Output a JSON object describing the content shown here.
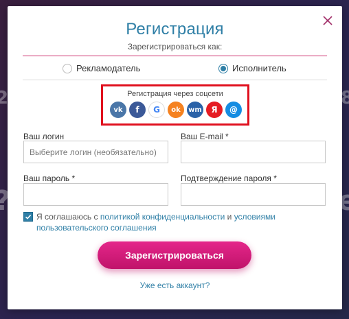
{
  "dialog": {
    "title": "Регистрация",
    "subtitle": "Зарегистрироваться как:",
    "close_icon": "close-icon"
  },
  "roles": {
    "advertiser": {
      "label": "Рекламодатель",
      "checked": false
    },
    "performer": {
      "label": "Исполнитель",
      "checked": true
    }
  },
  "social": {
    "label": "Регистрация через соцсети",
    "icons": [
      {
        "name": "vk-icon",
        "glyph": "vk",
        "color": "#4a76a8"
      },
      {
        "name": "facebook-icon",
        "glyph": "f",
        "color": "#3b5998"
      },
      {
        "name": "google-icon",
        "glyph": "G",
        "color": "#ffffff"
      },
      {
        "name": "odnoklassniki-icon",
        "glyph": "ok",
        "color": "#f58220"
      },
      {
        "name": "webmoney-icon",
        "glyph": "wm",
        "color": "#2a62a8"
      },
      {
        "name": "yandex-icon",
        "glyph": "Я",
        "color": "#e51c23"
      },
      {
        "name": "mailru-icon",
        "glyph": "@",
        "color": "#168de2"
      }
    ]
  },
  "form": {
    "login_label": "Ваш логин",
    "login_placeholder": "Выберите логин (необязательно)",
    "email_label": "Ваш E-mail *",
    "password_label": "Ваш пароль *",
    "confirm_label": "Подтверждение пароля *"
  },
  "agreement": {
    "checked": true,
    "prefix": "Я соглашаюсь с ",
    "privacy_link": "политикой конфиденциальности",
    "middle": " и ",
    "terms_link": "условиями пользовательского соглашения"
  },
  "submit_label": "Зарегистрироваться",
  "login_link": "Уже есть аккаунт?",
  "colors": {
    "accent": "#2f7fa6",
    "brand_pink": "#cc2b6a",
    "highlight_red": "#e0101e"
  }
}
